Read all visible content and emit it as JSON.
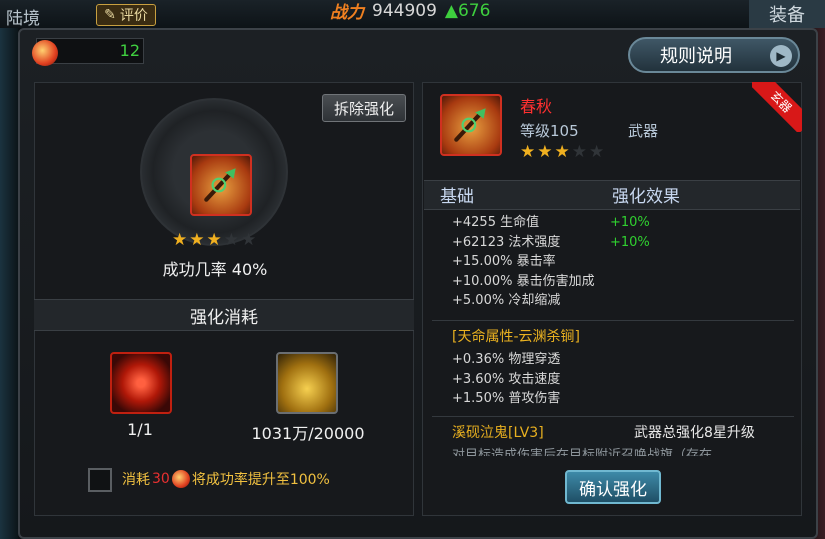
{
  "top_bar": {
    "left_label": "陆境",
    "rate_label": "评价",
    "power_label": "战力",
    "power_value": "944909",
    "power_increase": "676",
    "equip_label": "装备"
  },
  "currency": {
    "gem_count": "12"
  },
  "rules_button": {
    "label": "规则说明"
  },
  "left_panel": {
    "remove_button": "拆除强化",
    "stars": {
      "filled": 3,
      "total": 5
    },
    "success_rate": "成功几率 40%",
    "cost_title": "强化消耗",
    "costs": [
      {
        "icon": "red-gem-stone-icon",
        "amount": "1/1"
      },
      {
        "icon": "gold-coins-icon",
        "amount": "1031万/20000"
      }
    ],
    "consume_prefix": "消耗",
    "consume_num": "30",
    "consume_suffix": "将成功率提升至100%"
  },
  "item": {
    "name": "春秋",
    "level": "等级105",
    "type": "武器",
    "rarity": "玄器",
    "stars": {
      "filled": 3,
      "total": 5
    }
  },
  "stats": {
    "header_base": "基础",
    "header_effect": "强化效果",
    "rows": [
      {
        "name": "+4255 生命值",
        "bonus": "+10%"
      },
      {
        "name": "+62123 法术强度",
        "bonus": "+10%"
      },
      {
        "name": "+15.00% 暴击率",
        "bonus": ""
      },
      {
        "name": "+10.00% 暴击伤害加成",
        "bonus": ""
      },
      {
        "name": "+5.00% 冷却缩减",
        "bonus": ""
      }
    ]
  },
  "fate": {
    "title": "[天命属性-云渊杀锏]",
    "rows": [
      "+0.36% 物理穿透",
      "+3.60% 攻击速度",
      "+1.50% 普攻伤害"
    ]
  },
  "skill": {
    "title": "溪砚泣鬼[LV3]",
    "note": "武器总强化8星升级",
    "desc_clipped": "对目标造成伤害后在目标附近召唤战旗（存在"
  },
  "confirm_button": {
    "label": "确认强化"
  },
  "colors": {
    "accent_red": "#ff3030",
    "bonus_green": "#30d030",
    "gold_title": "#e8b020",
    "power_orange": "#f08020"
  }
}
